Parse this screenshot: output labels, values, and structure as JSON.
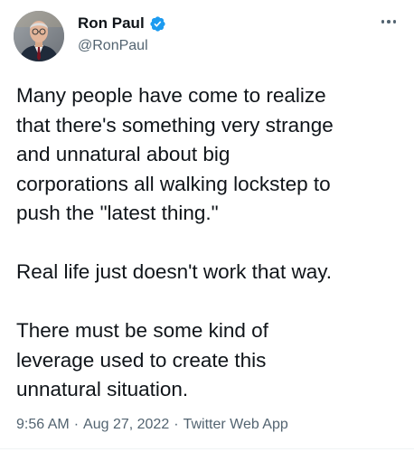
{
  "author": {
    "display_name": "Ron Paul",
    "handle": "@RonPaul",
    "verified": true,
    "avatar": "profile-photo"
  },
  "menu": {
    "icon": "more-options-icon"
  },
  "tweet": {
    "paragraphs": [
      "Many people have come to realize\nthat there's something very strange\nand unnatural about big\ncorporations all walking lockstep to\npush the \"latest thing.\"",
      "Real life just doesn't work that way.",
      "There must be some kind of\nleverage used to create this\nunnatural situation."
    ]
  },
  "meta": {
    "time": "9:56 AM",
    "date": "Aug 27, 2022",
    "source": "Twitter Web App",
    "separator": "·"
  },
  "colors": {
    "text_primary": "#0f1419",
    "text_secondary": "#536471",
    "verified_blue": "#1d9bf0"
  }
}
